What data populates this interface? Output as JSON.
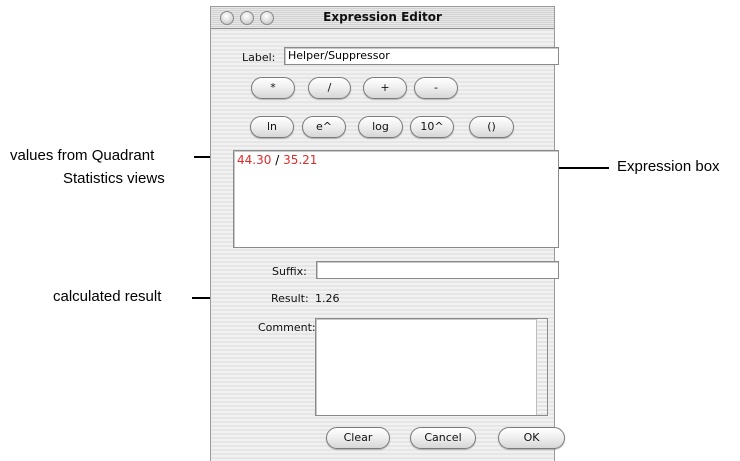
{
  "window": {
    "title": "Expression Editor"
  },
  "label_field": {
    "label": "Label:",
    "value": "Helper/Suppressor"
  },
  "operators": [
    "*",
    "/",
    "+",
    "-"
  ],
  "functions": [
    "ln",
    "e^",
    "log",
    "10^",
    "()"
  ],
  "expression": {
    "value1": "44.30",
    "operator": "/",
    "value2": "35.21"
  },
  "suffix": {
    "label": "Suffix:",
    "value": ""
  },
  "result": {
    "label": "Result:",
    "value": "1.26"
  },
  "comment": {
    "label": "Comment:",
    "value": ""
  },
  "buttons": {
    "clear": "Clear",
    "cancel": "Cancel",
    "ok": "OK"
  },
  "callouts": {
    "values_line1": "values from Quadrant",
    "values_line2": "Statistics views",
    "expression_box": "Expression box",
    "calculated_result": "calculated result"
  },
  "colors": {
    "expression_value": "#e12b2b"
  }
}
